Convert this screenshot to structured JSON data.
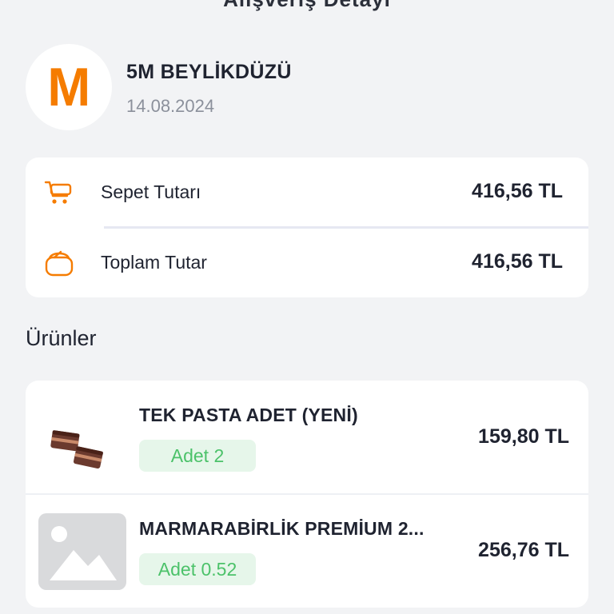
{
  "header": {
    "title_partial": "Alışveriş Detayı"
  },
  "store": {
    "logo_letter": "M",
    "name": "5M BEYLİKDÜZÜ",
    "date": "14.08.2024",
    "brand_color": "#f57c00"
  },
  "summary": {
    "rows": [
      {
        "icon": "cart-icon",
        "label": "Sepet Tutarı",
        "value": "416,56 TL"
      },
      {
        "icon": "wallet-icon",
        "label": "Toplam Tutar",
        "value": "416,56 TL"
      }
    ]
  },
  "products": {
    "title": "Ürünler",
    "items": [
      {
        "name": "TEK PASTA ADET (YENİ)",
        "quantity": "Adet 2",
        "price": "159,80 TL",
        "image": "cake-image"
      },
      {
        "name": "MARMARABİRLİK PREMİUM 2...",
        "quantity": "Adet 0.52",
        "price": "256,76 TL",
        "image": "placeholder-image-icon"
      }
    ]
  },
  "colors": {
    "accent_orange": "#f57c00",
    "badge_green_text": "#4cc26a",
    "badge_green_bg": "#e6f6ea",
    "background": "#f2f3f5"
  }
}
